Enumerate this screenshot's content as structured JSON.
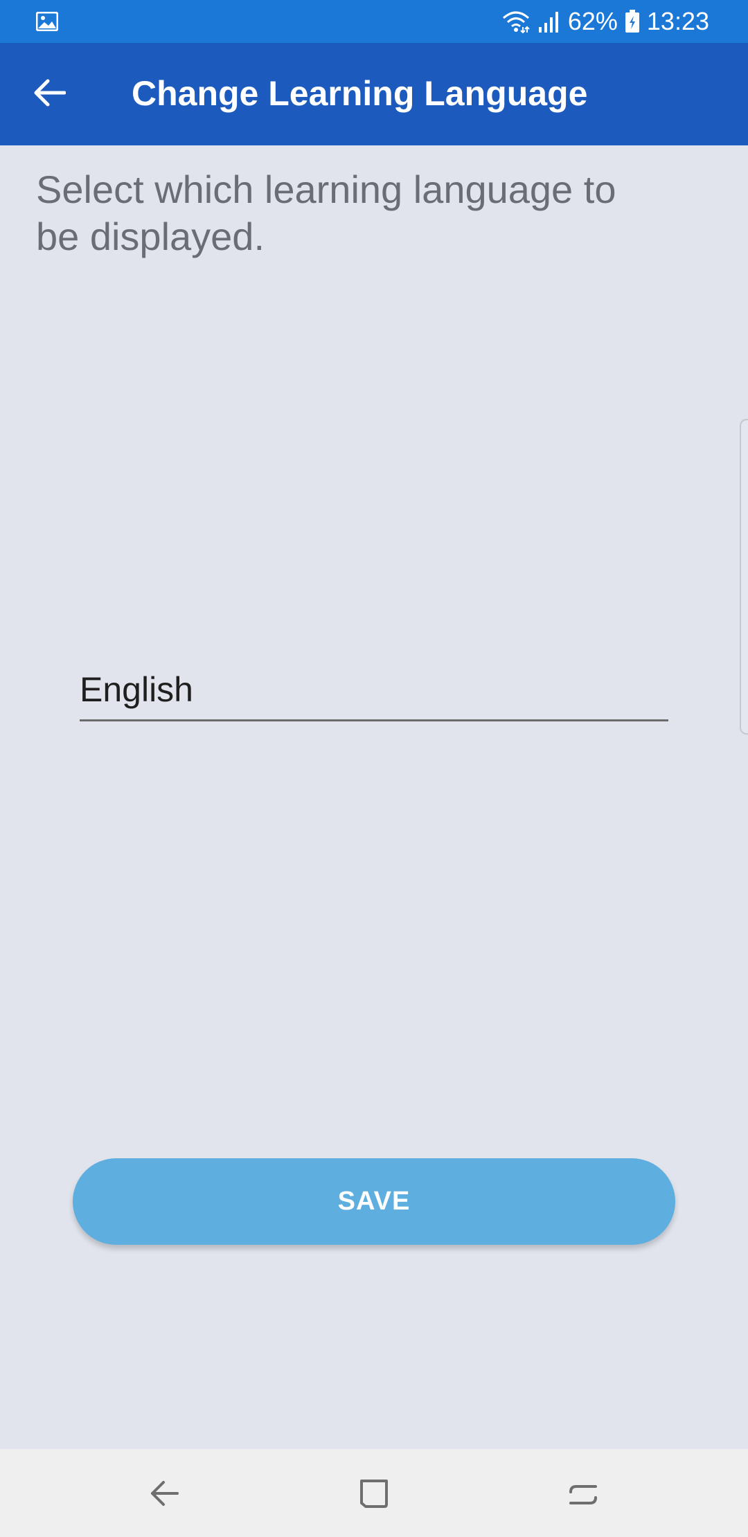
{
  "status_bar": {
    "notification_icon": "gallery-icon",
    "wifi_icon": "wifi-icon",
    "signal_icon": "cell-signal-icon",
    "battery_percent": "62%",
    "battery_icon": "battery-charging-icon",
    "time": "13:23"
  },
  "app_bar": {
    "back_icon": "arrow-back-icon",
    "title": "Change Learning Language"
  },
  "content": {
    "instruction": "Select which learning language to be displayed.",
    "selected_language": "English",
    "save_label": "SAVE"
  },
  "nav_bar": {
    "back_icon": "nav-back-icon",
    "home_icon": "nav-home-icon",
    "recents_icon": "nav-recents-icon"
  },
  "colors": {
    "status_bar": "#1b78d6",
    "app_bar": "#1c5bbd",
    "background": "#e1e4ec",
    "save_button": "#5eafe0",
    "instruction_text": "#6a6d75",
    "nav_bar": "#efefef"
  }
}
